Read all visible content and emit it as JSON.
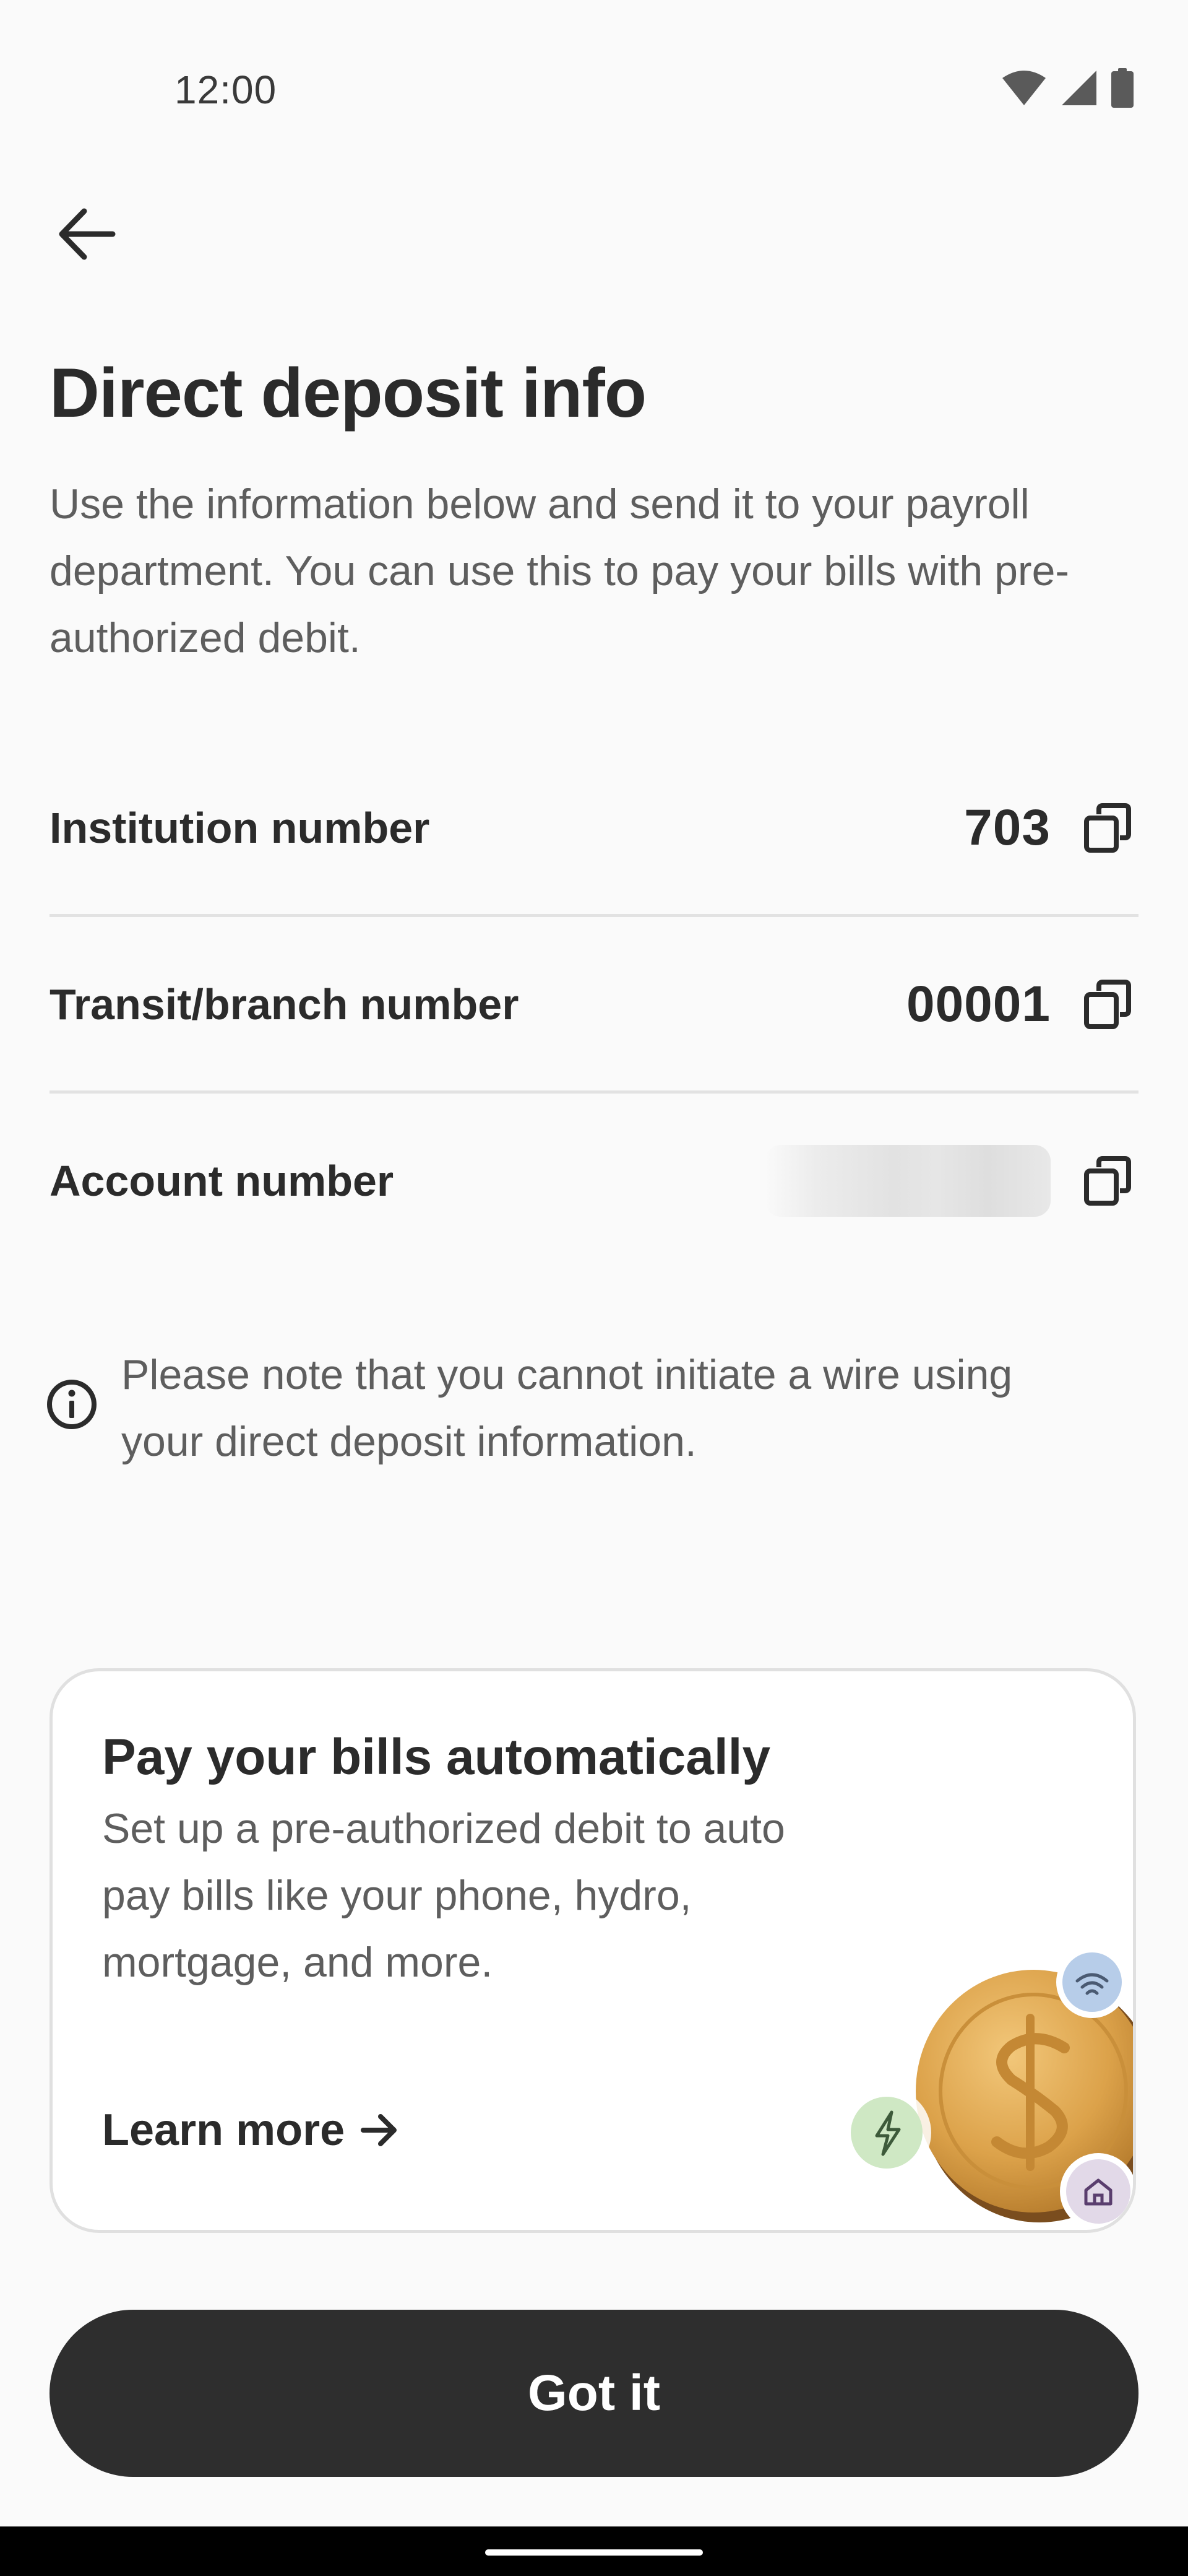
{
  "status_bar": {
    "time": "12:00",
    "icons": [
      "wifi-icon",
      "signal-icon",
      "battery-icon"
    ]
  },
  "header": {
    "back_icon": "arrow-left-icon"
  },
  "page": {
    "title": "Direct deposit info",
    "description": "Use the information below and send it to your payroll department. You can use this to pay your bills with pre-authorized debit."
  },
  "rows": [
    {
      "label": "Institution number",
      "value": "703",
      "copy_icon": "copy-icon"
    },
    {
      "label": "Transit/branch number",
      "value": "00001",
      "copy_icon": "copy-icon"
    },
    {
      "label": "Account number",
      "value": "",
      "copy_icon": "copy-icon"
    }
  ],
  "note": {
    "icon": "info-icon",
    "text": "Please note that you cannot initiate a wire using your direct deposit information."
  },
  "promo": {
    "title": "Pay your bills automatically",
    "description": "Set up a pre-authorized debit to auto pay bills like your phone, hydro, mortgage, and more.",
    "link_label": "Learn more",
    "link_icon": "arrow-right-icon",
    "illustration_icons": [
      "coin-icon",
      "wifi-icon",
      "lightning-icon",
      "home-icon"
    ]
  },
  "primary_button": {
    "label": "Got it"
  },
  "colors": {
    "background": "#fafafa",
    "primary_button": "#2e2e2e",
    "text": "#2b2b2b",
    "muted_text": "#5e5e5e",
    "coin": "#dca24a",
    "badge_blue": "#b7cde9",
    "badge_green": "#cfe8c4",
    "badge_purple": "#e2d9e8"
  }
}
